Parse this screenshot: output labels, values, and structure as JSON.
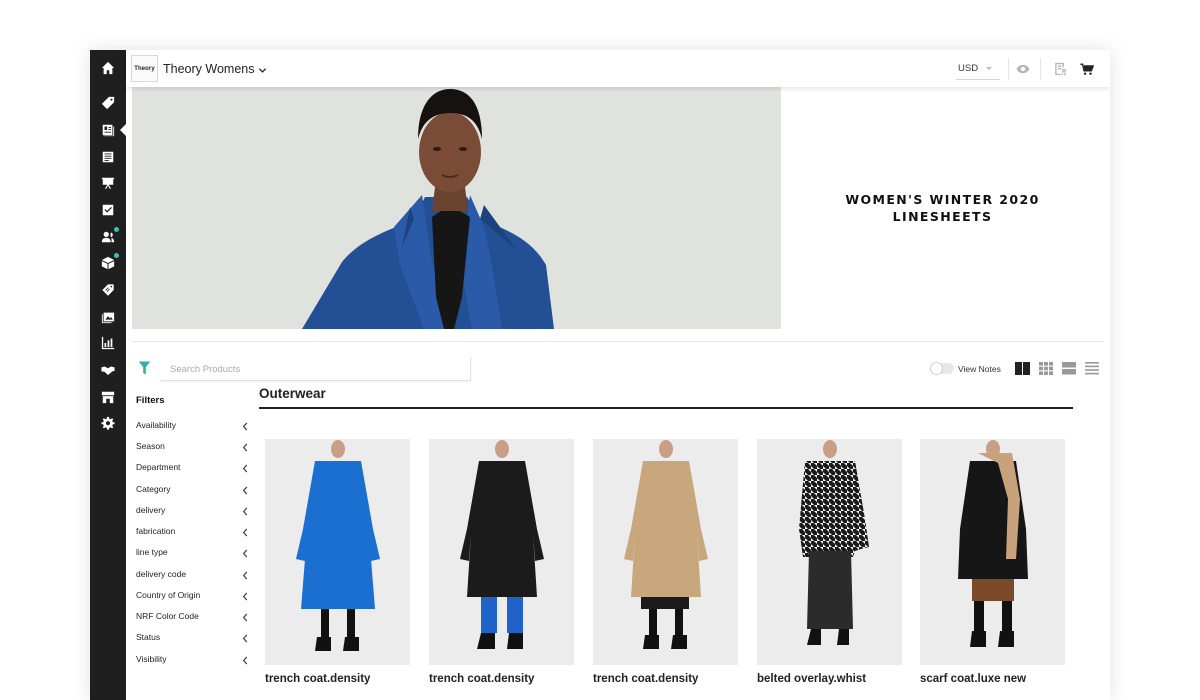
{
  "app": {
    "brand_logo_text": "Theory",
    "brand_name": "Theory Womens",
    "currency": "USD"
  },
  "sidebar": {
    "items": [
      {
        "icon": "home-icon"
      },
      {
        "icon": "tag-icon"
      },
      {
        "icon": "linesheet-icon",
        "active": true
      },
      {
        "icon": "catalog-icon"
      },
      {
        "icon": "presentation-icon"
      },
      {
        "icon": "checklist-icon"
      },
      {
        "icon": "customers-icon",
        "badge": true
      },
      {
        "icon": "box-icon",
        "badge": true
      },
      {
        "icon": "discount-tag-icon"
      },
      {
        "icon": "images-icon"
      },
      {
        "icon": "chart-icon"
      },
      {
        "icon": "handshake-icon"
      },
      {
        "icon": "storefront-icon"
      },
      {
        "icon": "gear-icon"
      }
    ]
  },
  "banner": {
    "title_line1": "WOMEN'S WINTER 2020",
    "title_line2": "LINESHEETS"
  },
  "search": {
    "placeholder": "Search Products"
  },
  "filters": {
    "title": "Filters",
    "items": [
      "Availability",
      "Season",
      "Department",
      "Category",
      "delivery",
      "fabrication",
      "line type",
      "delivery code",
      "Country of Origin",
      "NRF Color Code",
      "Status",
      "Visibility"
    ]
  },
  "toolbar": {
    "view_notes_label": "View Notes"
  },
  "section": {
    "title": "Outerwear"
  },
  "products": [
    {
      "name": "trench coat.density",
      "color": "#1a6fd0"
    },
    {
      "name": "trench coat.density",
      "color": "#1b1b1b"
    },
    {
      "name": "trench coat.density",
      "color": "#c9a77d"
    },
    {
      "name": "belted overlay.whist",
      "color": "#2b2b2b"
    },
    {
      "name": "scarf coat.luxe new",
      "color": "#161616"
    }
  ]
}
